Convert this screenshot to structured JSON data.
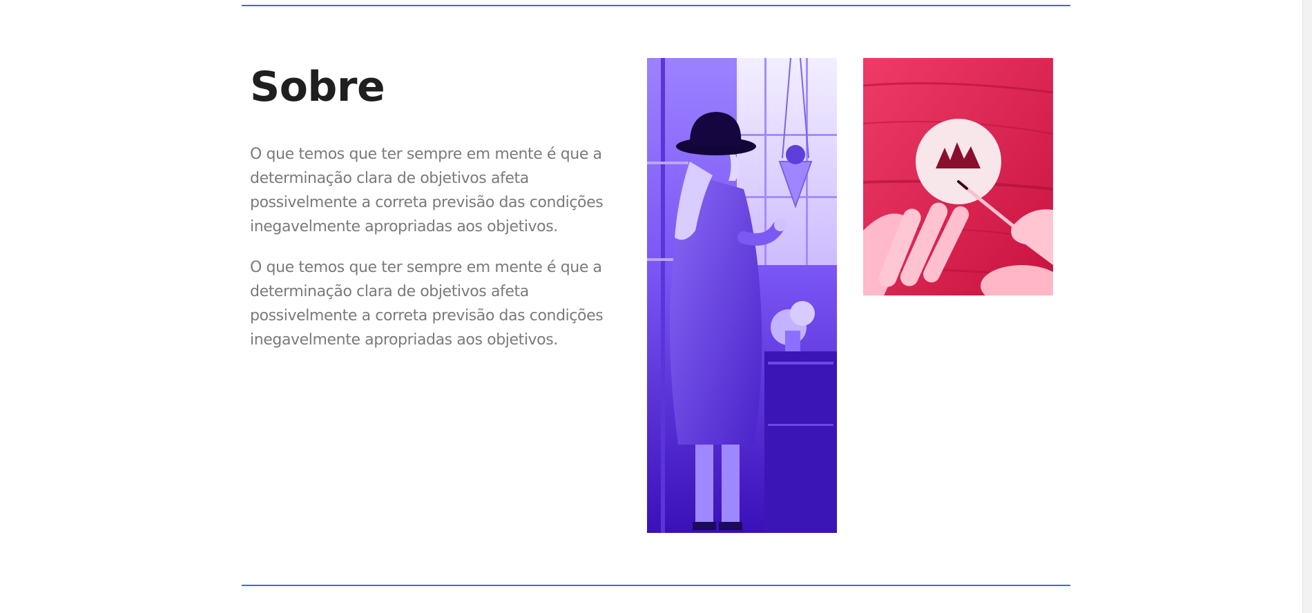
{
  "about": {
    "title": "Sobre",
    "paragraphs": [
      "O que temos que ter sempre em mente é que a determinação clara de objetivos afeta possivelmente a correta previsão das condições inegavelmente apropriadas aos objetivos.",
      "O que temos que ter sempre em mente é que a determinação clara de objetivos afeta possivelmente a correta previsão das condições inegavelmente apropriadas aos objetivos."
    ]
  },
  "colors": {
    "accent_rule": "#2f6fe0",
    "title": "#1f1f1f",
    "body_text": "#7a7a7a",
    "photo_tint_purple": "#6a3cf0",
    "photo_tint_pink": "#e8285a"
  }
}
